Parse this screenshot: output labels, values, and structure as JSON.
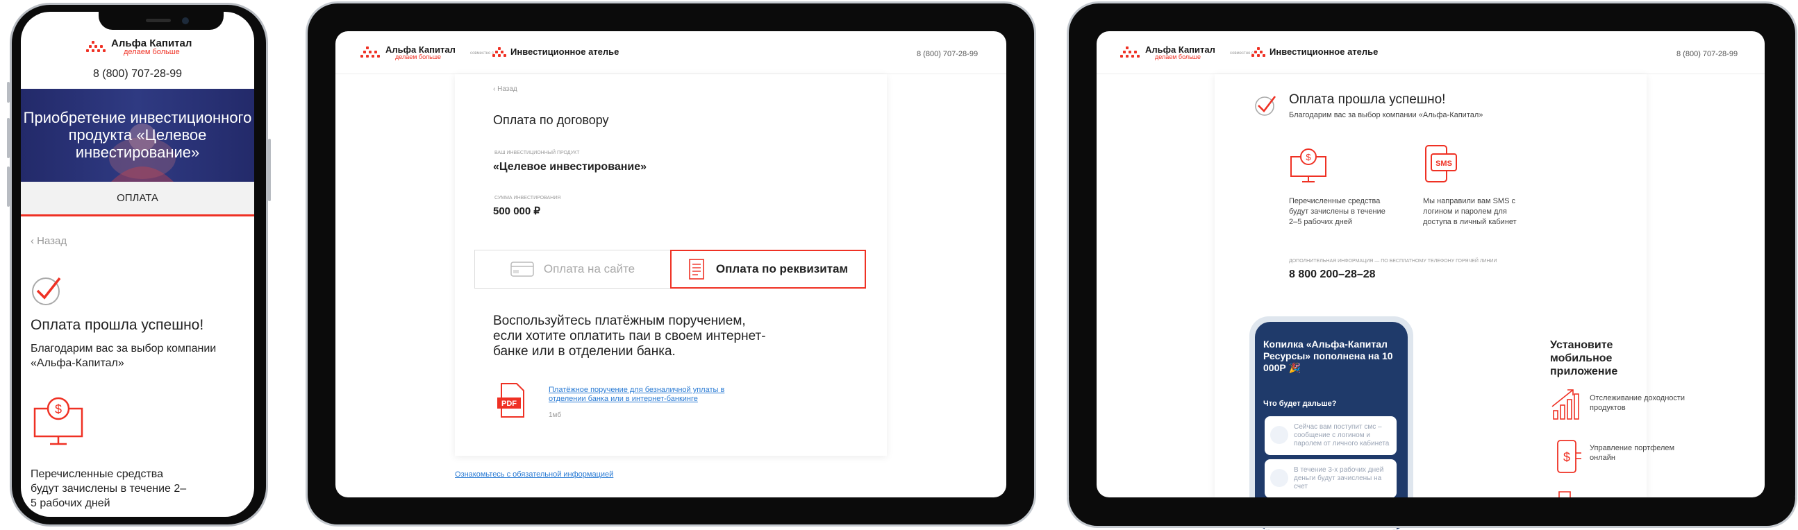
{
  "brand": {
    "name": "Альфа Капитал",
    "tagline": "делаем больше",
    "together": "совместно с",
    "partner": "Инвестиционное ателье",
    "phone": "8 (800) 707-28-99"
  },
  "mobile": {
    "phone": "8 (800) 707-28-99",
    "banner_title": "Приобретение инвестиционного продукта «Целевое инвестирование»",
    "tab_label": "ОПЛАТА",
    "back": "Назад",
    "success_title": "Оплата прошла успешно!",
    "success_text": "Благодарим вас за выбор компании «Альфа-Капитал»",
    "info_text": "Перечисленные средства будут зачислены в течение 2–5 рабочих дней"
  },
  "payment_page": {
    "back": "Назад",
    "title": "Оплата по договору",
    "product_label": "ВАШ ИНВЕСТИЦИОННЫЙ ПРОДУКТ",
    "product_value": "«Целевое инвестирование»",
    "amount_label": "СУММА ИНВЕСТИРОВАНИЯ",
    "amount_value": "500 000 ₽",
    "tab_online": "Оплата на сайте",
    "tab_requisites": "Оплата по реквизитам",
    "instruction": "Воспользуйтесь платёжным поручением, если хотите оплатить паи в своем интернет-банке или в отделении банка.",
    "file_link": "Платёжное поручение для безналичной уплаты в отделении банка или в интернет-банкинге",
    "file_size": "1мб",
    "file_badge": "PDF",
    "footer_link": "Ознакомьтесь с обязательной информацией"
  },
  "success_page": {
    "title": "Оплата прошла успешно!",
    "subtitle": "Благодарим вас за выбор компании «Альфа-Капитал»",
    "feature1": "Перечисленные средства будут зачислены в течение 2–5 рабочих дней",
    "feature2": "Мы направили вам SMS с логином и паролем для доступа в личный кабинет",
    "sms_badge": "SMS",
    "extra_label": "ДОПОЛНИТЕЛЬНАЯ ИНФОРМАЦИЯ — ПО БЕСПЛАТНОМУ ТЕЛЕФОНУ ГОРЯЧЕЙ ЛИНИИ",
    "hotline": "8 800 200–28–28",
    "app_mock": {
      "headline": "Копилка «Альфа-Капитал Ресурсы» пополнена на 10 000Р 🎉",
      "next": "Что будет дальше?",
      "card1": "Сейчас вам поступит смс – сообщение с логином и паролем от личного кабинета",
      "card2": "В течение 3-х рабочих дней деньги будут зачислены на счет"
    },
    "install_title": "Установите мобильное приложение",
    "app_feature1": "Отслеживание доходности продуктов",
    "app_feature2": "Управление портфелем онлайн"
  },
  "colors": {
    "accent": "#ef3124",
    "banner": "#2f3a82",
    "link": "#2a7bd4",
    "app_bg": "#1f3a6a"
  }
}
